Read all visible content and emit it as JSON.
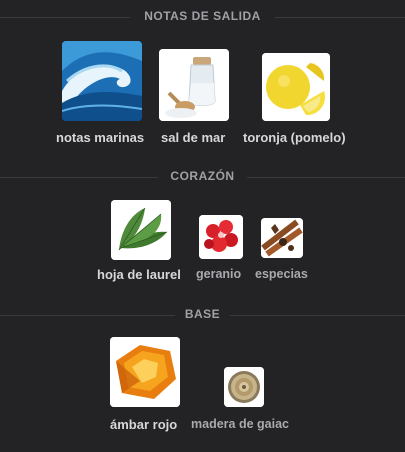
{
  "sections": [
    {
      "title": "NOTAS DE SALIDA",
      "notes": [
        {
          "label": "notas marinas",
          "icon": "ocean-wave-icon"
        },
        {
          "label": "sal de mar",
          "icon": "sea-salt-icon"
        },
        {
          "label": "toronja (pomelo)",
          "icon": "grapefruit-icon"
        }
      ]
    },
    {
      "title": "CORAZÓN",
      "notes": [
        {
          "label": "hoja de laurel",
          "icon": "bay-leaf-icon"
        },
        {
          "label": "geranio",
          "icon": "geranium-icon"
        },
        {
          "label": "especias",
          "icon": "spices-icon"
        }
      ]
    },
    {
      "title": "BASE",
      "notes": [
        {
          "label": "ámbar rojo",
          "icon": "amber-icon"
        },
        {
          "label": "madera de gaiac",
          "icon": "guaiac-wood-icon"
        }
      ]
    }
  ],
  "colors": {
    "background": "#232325",
    "divider": "#3a3a3d",
    "section_title": "#a0a0a6",
    "note_primary": "#d7d7da",
    "note_secondary": "#a9a9ae"
  }
}
